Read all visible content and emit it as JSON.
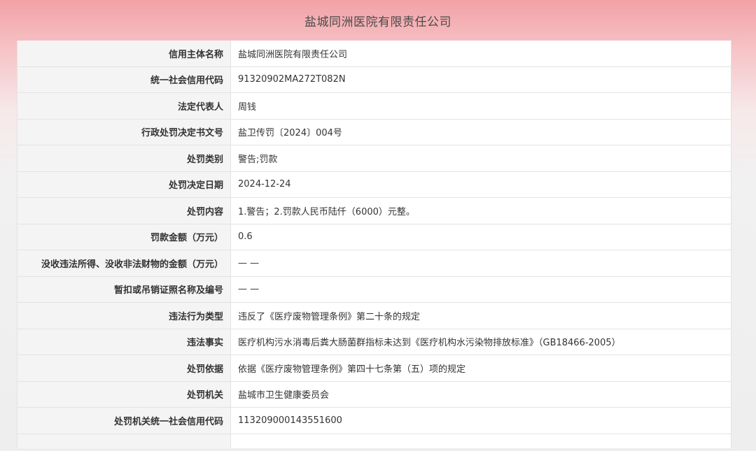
{
  "header": {
    "title": "盐城同洲医院有限责任公司"
  },
  "rows": [
    {
      "label": "信用主体名称",
      "value": "盐城同洲医院有限责任公司"
    },
    {
      "label": "统一社会信用代码",
      "value": "91320902MA272T082N"
    },
    {
      "label": "法定代表人",
      "value": "周钱"
    },
    {
      "label": "行政处罚决定书文号",
      "value": "盐卫传罚〔2024〕004号"
    },
    {
      "label": "处罚类别",
      "value": "警告;罚款"
    },
    {
      "label": "处罚决定日期",
      "value": "2024-12-24"
    },
    {
      "label": "处罚内容",
      "value": "1.警告；2.罚款人民币陆仟（6000）元整。"
    },
    {
      "label": "罚款金额（万元）",
      "value": "0.6"
    },
    {
      "label": "没收违法所得、没收非法财物的金额（万元）",
      "value": "— —"
    },
    {
      "label": "暂扣或吊销证照名称及编号",
      "value": "— —"
    },
    {
      "label": "违法行为类型",
      "value": "违反了《医疗废物管理条例》第二十条的规定"
    },
    {
      "label": "违法事实",
      "value": "医疗机构污水消毒后粪大肠菌群指标未达到《医疗机构水污染物排放标准》（GB18466-2005）"
    },
    {
      "label": "处罚依据",
      "value": "依据《医疗废物管理条例》第四十七条第（五）项的规定"
    },
    {
      "label": "处罚机关",
      "value": "盐城市卫生健康委员会"
    },
    {
      "label": "处罚机关统一社会信用代码",
      "value": "113209000143551600"
    }
  ]
}
